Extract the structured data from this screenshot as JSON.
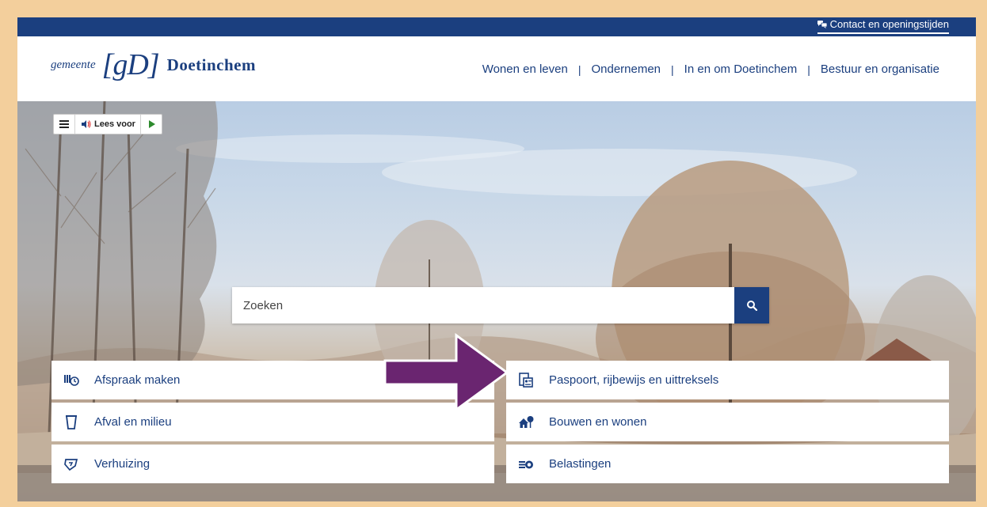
{
  "topbar": {
    "contact_label": "Contact en openingstijden",
    "contact_icon": "speech-bubbles-icon"
  },
  "header": {
    "logo": {
      "prefix": "gemeente",
      "mark": "[gD]",
      "name": "Doetinchem"
    },
    "nav": [
      {
        "label": "Wonen en leven"
      },
      {
        "label": "Ondernemen"
      },
      {
        "label": "In en om Doetinchem"
      },
      {
        "label": "Bestuur en organisatie"
      }
    ],
    "separator": "|"
  },
  "readbar": {
    "menu_icon": "menu-icon",
    "speak_icon": "speaker-icon",
    "speak_label": "Lees voor",
    "play_icon": "play-icon"
  },
  "search": {
    "placeholder": "Zoeken",
    "button_icon": "search-icon"
  },
  "tiles": [
    {
      "label": "Afspraak maken",
      "icon": "calendar-clock-icon"
    },
    {
      "label": "Paspoort, rijbewijs en uittreksels",
      "icon": "id-card-icon"
    },
    {
      "label": "Afval en milieu",
      "icon": "waste-bin-icon"
    },
    {
      "label": "Bouwen en wonen",
      "icon": "house-tree-icon"
    },
    {
      "label": "Verhuizing",
      "icon": "moving-box-icon"
    },
    {
      "label": "Belastingen",
      "icon": "coins-icon"
    }
  ],
  "colors": {
    "brand_blue": "#1b3f7f",
    "annotation_arrow": "#6a2570",
    "frame_border": "#f3cf9c"
  }
}
